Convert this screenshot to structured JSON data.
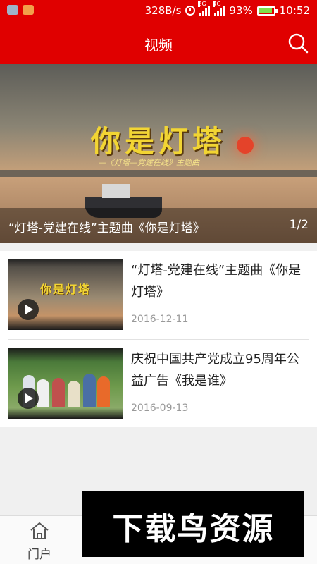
{
  "status_bar": {
    "net_speed": "328B/s",
    "network_2g": "2G",
    "network_4g": "4G",
    "battery_percent": "93%",
    "battery_level": 0.93,
    "time": "10:52"
  },
  "header": {
    "title": "视频",
    "search_icon": "search-icon"
  },
  "banner": {
    "image_title": "你是灯塔",
    "image_subtitle": "—《灯塔—党建在线》主题曲",
    "caption": "“灯塔-党建在线”主题曲《你是灯塔》",
    "index": "1/2"
  },
  "videos": [
    {
      "title": "“灯塔-党建在线”主题曲《你是灯塔》",
      "thumb_title": "你是灯塔",
      "date": "2016-12-11"
    },
    {
      "title": "庆祝中国共产党成立95周年公益广告《我是谁》",
      "date": "2016-09-13"
    }
  ],
  "bottom_nav": {
    "items": [
      {
        "label": "门户",
        "icon": "home-icon"
      }
    ]
  },
  "watermark": {
    "text": "下载鸟资源"
  },
  "colors": {
    "brand_red": "#e00000",
    "text_dark": "#222222",
    "text_muted": "#999999"
  }
}
